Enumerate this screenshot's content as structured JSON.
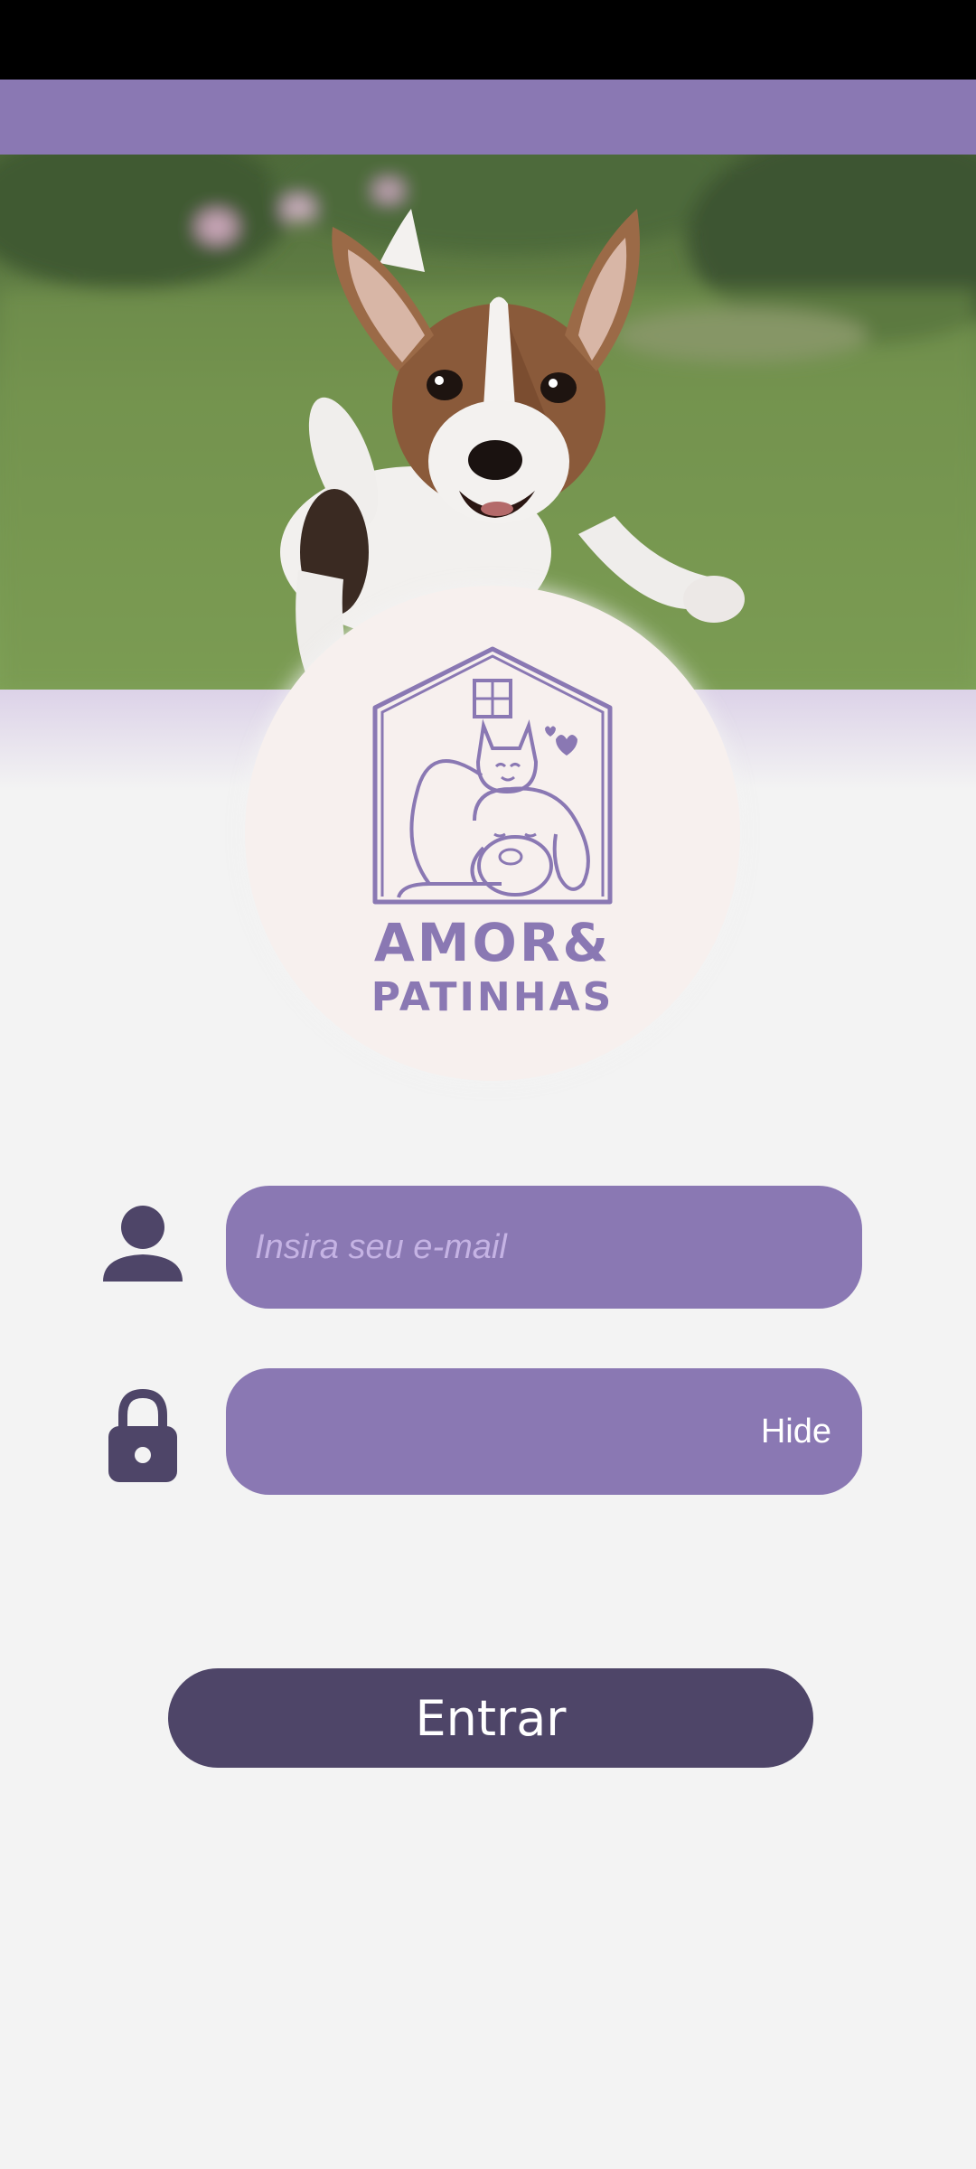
{
  "brand": {
    "line1": "AMOR&",
    "line2": "PATINHAS"
  },
  "hero": {
    "image": "puppy-running-on-grass-photo"
  },
  "login": {
    "email_placeholder": "Insira seu e-mail",
    "email_value": "",
    "password_value": "",
    "password_toggle_label": "Hide",
    "submit_label": "Entrar"
  },
  "icons": {
    "user": "person-icon",
    "lock": "lock-icon"
  },
  "colors": {
    "primary": "#8a78b3",
    "dark": "#4e4568",
    "background": "#f3f3f3",
    "logo_background": "#f7f0ee",
    "placeholder": "#c5b3e4"
  }
}
